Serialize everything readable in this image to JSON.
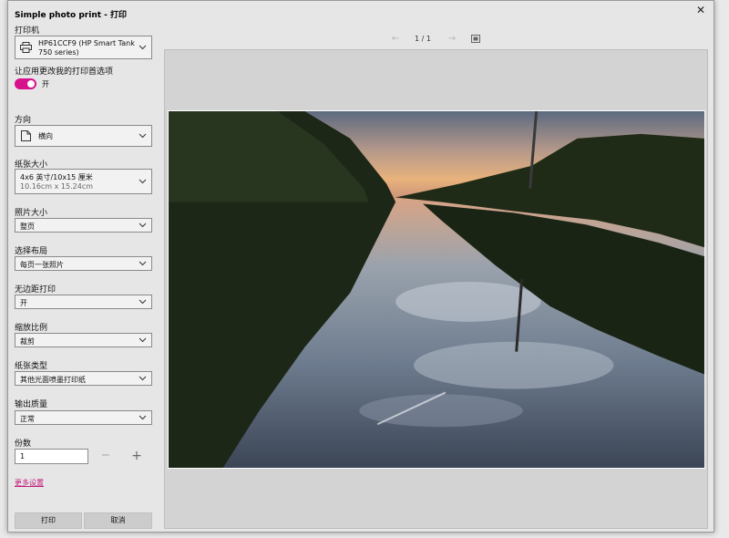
{
  "window": {
    "title": "Simple photo print - 打印"
  },
  "printer": {
    "label": "打印机",
    "value": "HP61CCF9 (HP Smart Tank 750 series)"
  },
  "app_pref": {
    "label": "让应用更改我的打印首选项",
    "toggle_state": "开"
  },
  "orientation": {
    "label": "方向",
    "value": "横向"
  },
  "paper_size": {
    "label": "纸张大小",
    "value": "4x6 英寸/10x15 厘米",
    "sub": "10.16cm x 15.24cm"
  },
  "photo_size": {
    "label": "照片大小",
    "value": "整页"
  },
  "layout": {
    "label": "选择布局",
    "value": "每页一张照片"
  },
  "borderless": {
    "label": "无边距打印",
    "value": "开"
  },
  "scale": {
    "label": "缩放比例",
    "value": "裁剪"
  },
  "paper_type": {
    "label": "纸张类型",
    "value": "其他光面喷墨打印纸"
  },
  "quality": {
    "label": "输出质量",
    "value": "正常"
  },
  "copies": {
    "label": "份数",
    "value": "1",
    "minus": "−",
    "plus": "+"
  },
  "more_settings": "更多设置",
  "buttons": {
    "print": "打印",
    "cancel": "取消"
  },
  "pager": {
    "page": "1 / 1",
    "prev": "←",
    "next": "→"
  },
  "colors": {
    "accent": "#d6118b",
    "link": "#c2187a"
  }
}
